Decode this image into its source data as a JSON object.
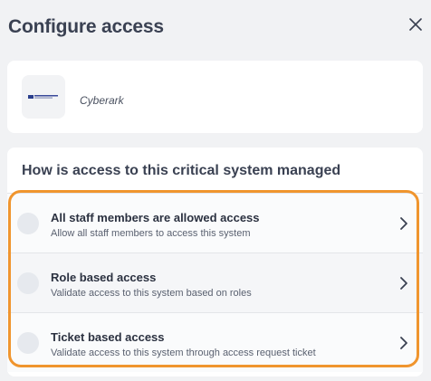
{
  "dialog": {
    "title": "Configure access"
  },
  "system": {
    "name": "Cyberark",
    "logo_icon": "cyberark-logo"
  },
  "question": {
    "text": "How is access to this critical system managed"
  },
  "options": [
    {
      "title": "All staff members are allowed access",
      "description": "Allow all staff members to access this system"
    },
    {
      "title": "Role based access",
      "description": "Validate access to this system based on roles"
    },
    {
      "title": "Ticket based access",
      "description": "Validate access to this system through access request ticket"
    }
  ],
  "colors": {
    "highlight": "#f0952e",
    "background": "#f1f2f4",
    "text": "#2b3140"
  }
}
